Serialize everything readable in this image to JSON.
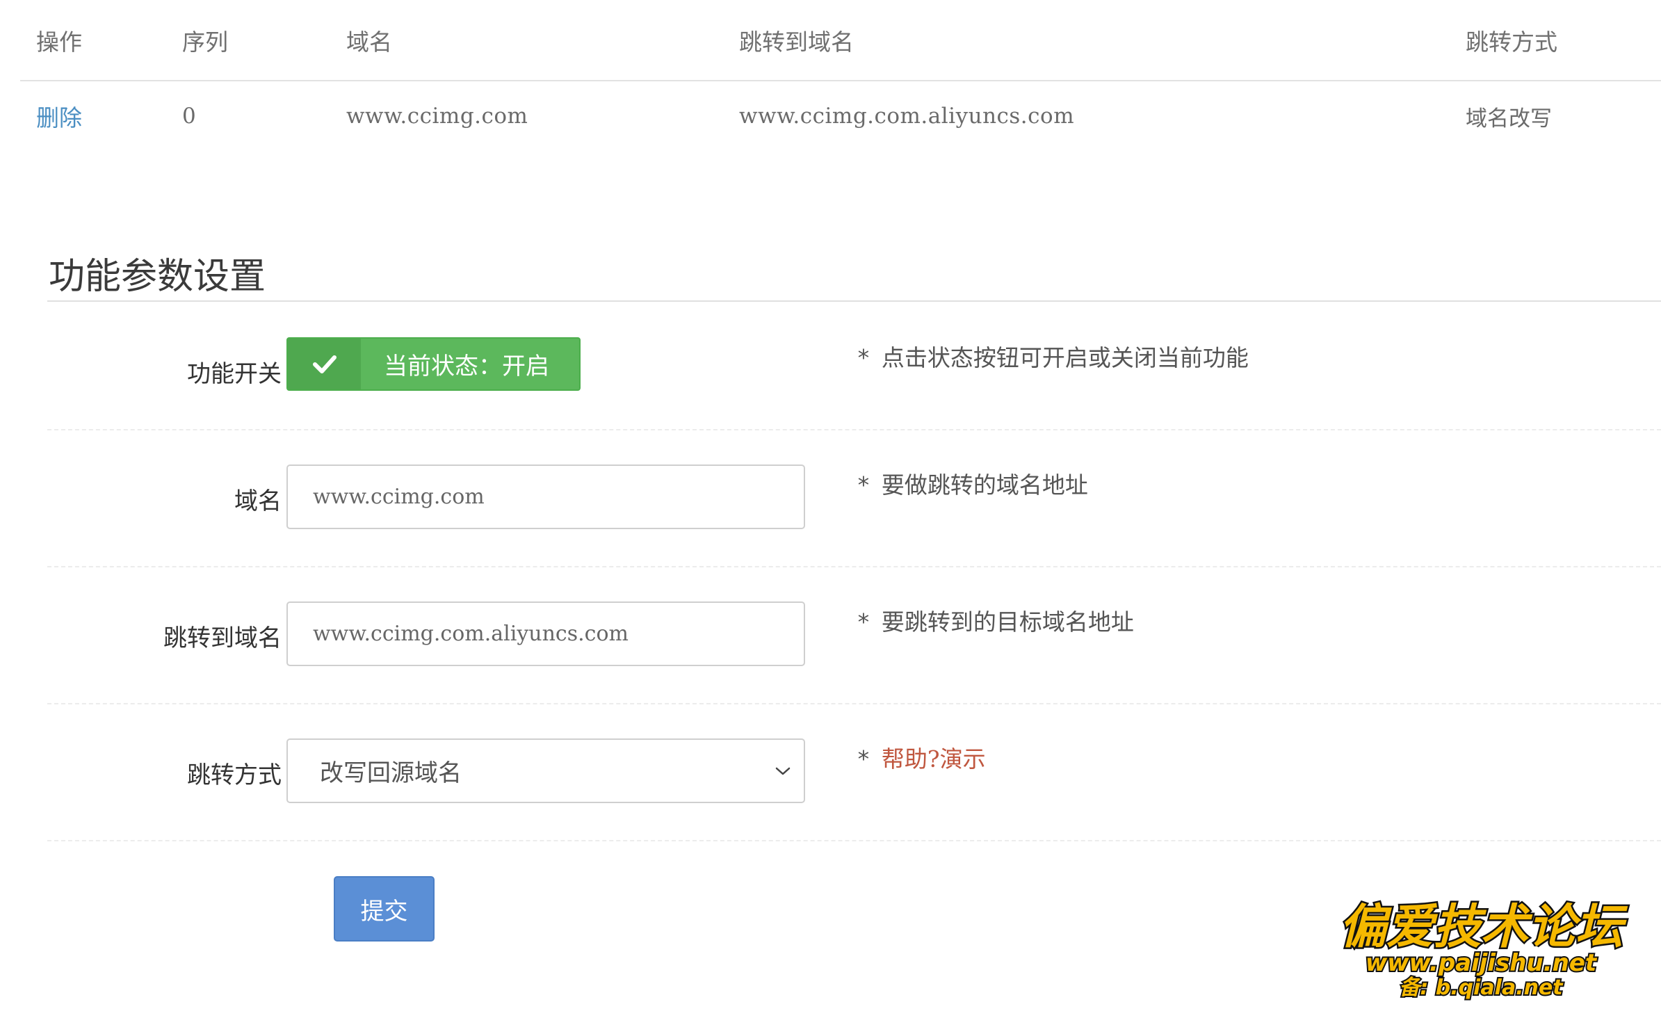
{
  "table": {
    "headers": {
      "op": "操作",
      "seq": "序列",
      "domain": "域名",
      "target": "跳转到域名",
      "mode": "跳转方式"
    },
    "rows": [
      {
        "op": "删除",
        "seq": "0",
        "domain": "www.ccimg.com",
        "target": "www.ccimg.com.aliyuncs.com",
        "mode": "域名改写"
      }
    ]
  },
  "section": {
    "title": "功能参数设置"
  },
  "form": {
    "switch": {
      "label": "功能开关",
      "button_text": "当前状态：开启",
      "hint": "点击状态按钮可开启或关闭当前功能"
    },
    "domain": {
      "label": "域名",
      "placeholder": "www.ccimg.com",
      "hint": "要做跳转的域名地址"
    },
    "target": {
      "label": "跳转到域名",
      "placeholder": "www.ccimg.com.aliyuncs.com",
      "hint": "要跳转到的目标域名地址"
    },
    "mode": {
      "label": "跳转方式",
      "selected": "改写回源域名",
      "hint_link": "帮助?演示"
    },
    "star": "*",
    "submit_label": "提交"
  },
  "watermark": {
    "line1": "偏爱技术论坛",
    "line2": "www.paijishu.net",
    "line3": "备: b.qiala.net"
  },
  "colors": {
    "toggle_green": "#5cb85c",
    "submit_blue": "#5b8fd6",
    "link_blue": "#4a8ec2",
    "help_red": "#c0573f",
    "watermark_yellow": "#f5b800"
  }
}
